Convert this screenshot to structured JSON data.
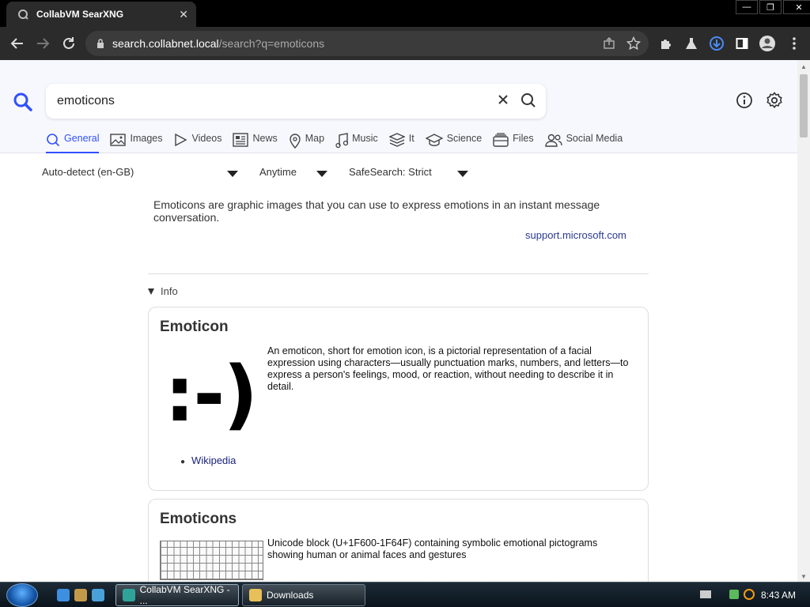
{
  "browser": {
    "tab_title": "CollabVM SearXNG",
    "tab_close": "✕",
    "url_host": "search.collabnet.local",
    "url_path": "/search?q=emoticons"
  },
  "search": {
    "query": "emoticons"
  },
  "categories": [
    {
      "label": "General",
      "icon": "search-icon",
      "active": true
    },
    {
      "label": "Images",
      "icon": "image-icon"
    },
    {
      "label": "Videos",
      "icon": "play-icon"
    },
    {
      "label": "News",
      "icon": "newspaper-icon"
    },
    {
      "label": "Map",
      "icon": "map-pin-icon"
    },
    {
      "label": "Music",
      "icon": "music-note-icon"
    },
    {
      "label": "It",
      "icon": "layers-icon"
    },
    {
      "label": "Science",
      "icon": "graduation-cap-icon"
    },
    {
      "label": "Files",
      "icon": "file-stack-icon"
    },
    {
      "label": "Social Media",
      "icon": "people-icon"
    }
  ],
  "filters": {
    "language": "Auto-detect (en-GB)",
    "time": "Anytime",
    "safesearch": "SafeSearch: Strict"
  },
  "answer": {
    "text": "Emoticons are graphic images that you can use to express emotions in an instant message conversation.",
    "source": "support.microsoft.com"
  },
  "info_toggle": "Info",
  "infobox1": {
    "title": "Emoticon",
    "art": ":-)",
    "description": "An emoticon, short for emotion icon, is a pictorial representation of a facial expression using characters—usually punctuation marks, numbers, and letters—to express a person's feelings, mood, or reaction, without needing to describe it in detail.",
    "link": "Wikipedia"
  },
  "infobox2": {
    "title": "Emoticons",
    "description": "Unicode block (U+1F600-1F64F) containing symbolic emotional pictograms showing human or animal faces and gestures"
  },
  "taskbar": {
    "task_browser": "CollabVM SearXNG - ...",
    "task_downloads": "Downloads",
    "clock": "8:43 AM"
  },
  "colors": {
    "accent": "#3050ff",
    "header_bg": "#f7f8fe",
    "link": "#1a237e"
  }
}
